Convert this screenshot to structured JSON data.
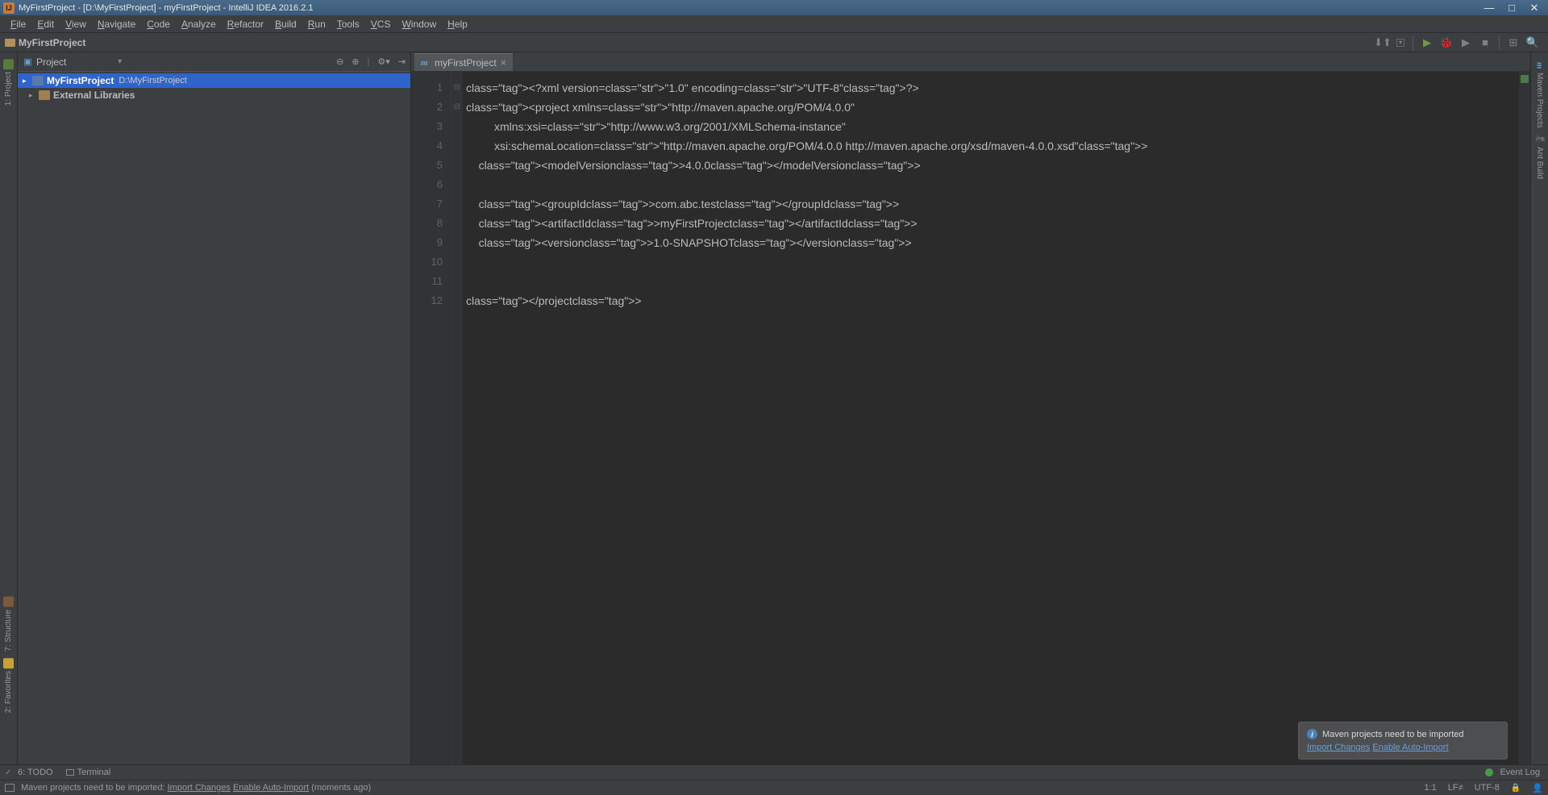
{
  "titlebar": {
    "text": "MyFirstProject - [D:\\MyFirstProject] - myFirstProject - IntelliJ IDEA 2016.2.1"
  },
  "menubar": {
    "items": [
      "File",
      "Edit",
      "View",
      "Navigate",
      "Code",
      "Analyze",
      "Refactor",
      "Build",
      "Run",
      "Tools",
      "VCS",
      "Window",
      "Help"
    ]
  },
  "breadcrumb": {
    "text": "MyFirstProject"
  },
  "project_panel": {
    "title": "Project",
    "tree": [
      {
        "label": "MyFirstProject",
        "path": "D:\\MyFirstProject",
        "icon": "folder",
        "selected": true
      },
      {
        "label": "External Libraries",
        "path": "",
        "icon": "lib",
        "selected": false
      }
    ]
  },
  "left_strip": {
    "top": [
      "1: Project"
    ],
    "bottom": [
      "7: Structure",
      "2: Favorites"
    ]
  },
  "right_strip": {
    "items": [
      "Maven Projects",
      "Ant Build"
    ]
  },
  "editor": {
    "tab_name": "myFirstProject",
    "line_count": 12,
    "code_lines": [
      {
        "raw": "<?xml version=\"1.0\" encoding=\"UTF-8\"?>"
      },
      {
        "raw": "<project xmlns=\"http://maven.apache.org/POM/4.0.0\""
      },
      {
        "raw": "         xmlns:xsi=\"http://www.w3.org/2001/XMLSchema-instance\""
      },
      {
        "raw": "         xsi:schemaLocation=\"http://maven.apache.org/POM/4.0.0 http://maven.apache.org/xsd/maven-4.0.0.xsd\">"
      },
      {
        "raw": "    <modelVersion>4.0.0</modelVersion>"
      },
      {
        "raw": ""
      },
      {
        "raw": "    <groupId>com.abc.test</groupId>"
      },
      {
        "raw": "    <artifactId>myFirstProject</artifactId>"
      },
      {
        "raw": "    <version>1.0-SNAPSHOT</version>"
      },
      {
        "raw": ""
      },
      {
        "raw": ""
      },
      {
        "raw": "</project>"
      }
    ]
  },
  "notification": {
    "title": "Maven projects need to be imported",
    "link1": "Import Changes",
    "link2": "Enable Auto-Import"
  },
  "bottom_toolbar": {
    "todo": "6: TODO",
    "terminal": "Terminal",
    "event_log": "Event Log"
  },
  "statusbar": {
    "message_prefix": "Maven projects need to be imported: ",
    "link1": "Import Changes",
    "link2": "Enable Auto-Import",
    "message_suffix": " (moments ago)",
    "position": "1:1",
    "line_sep": "LF≠",
    "encoding": "UTF-8"
  }
}
